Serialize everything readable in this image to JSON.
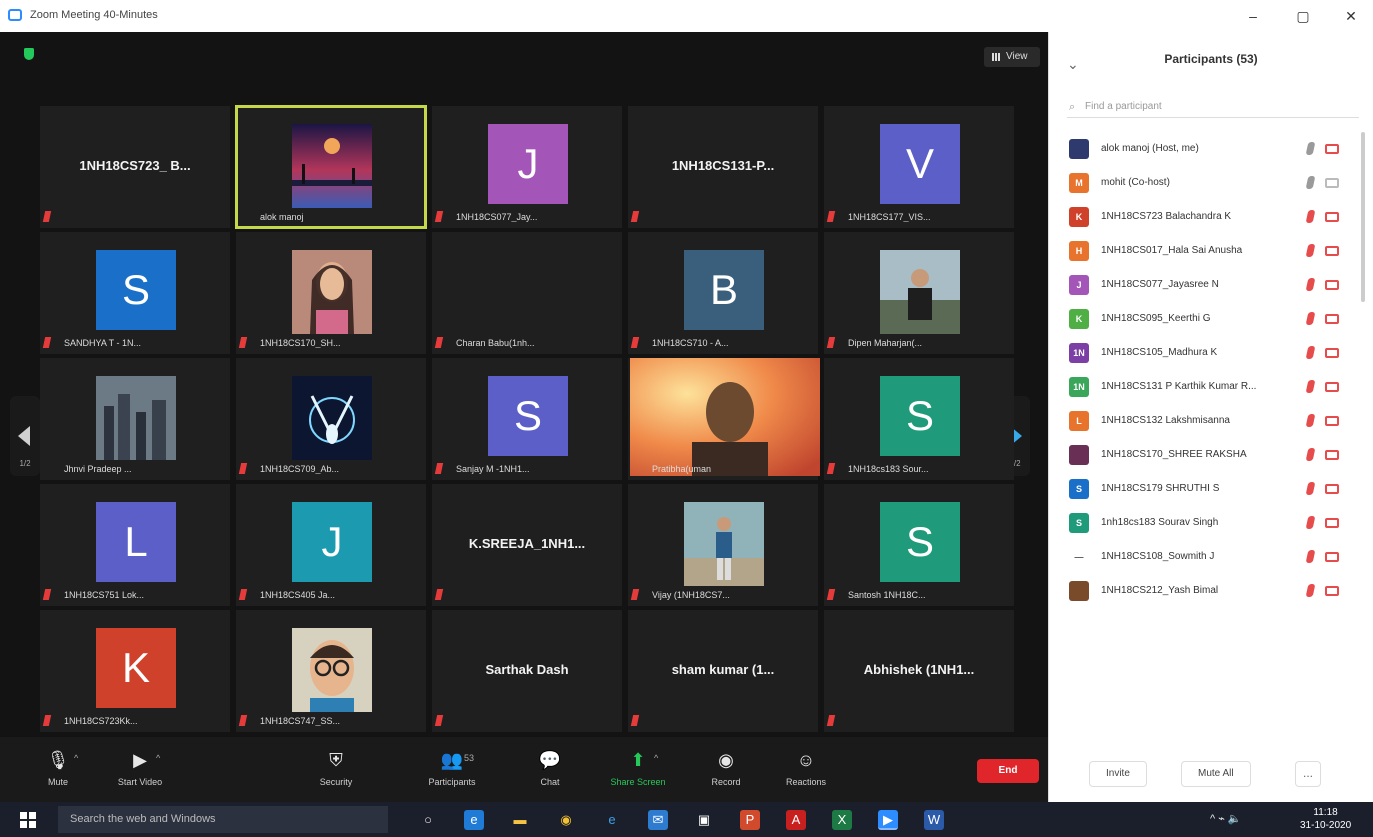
{
  "window": {
    "title": "Zoom Meeting 40-Minutes",
    "controls": [
      "–",
      "▢",
      "✕"
    ]
  },
  "meeting": {
    "view_label": "View",
    "nav_left_page": "1/2",
    "nav_right_page": "1/2",
    "tiles": [
      {
        "type": "text",
        "label": "1NH18CS723_ B...",
        "muted": true
      },
      {
        "type": "photo",
        "photo": "sunset-art",
        "name": "alok manoj",
        "muted": false,
        "active": true
      },
      {
        "type": "avatar",
        "letter": "J",
        "color": "#a455b8",
        "name": "1NH18CS077_Jay...",
        "muted": true
      },
      {
        "type": "text",
        "label": "1NH18CS131-P...",
        "muted": true
      },
      {
        "type": "avatar",
        "letter": "V",
        "color": "#5b5fc7",
        "name": "1NH18CS177_VIS...",
        "muted": true
      },
      {
        "type": "avatar",
        "letter": "S",
        "color": "#1a6fc9",
        "name": "SANDHYA T - 1N...",
        "muted": true
      },
      {
        "type": "photo",
        "photo": "woman-portrait",
        "name": "1NH18CS170_SH...",
        "muted": true
      },
      {
        "type": "blank",
        "name": "Charan Babu(1nh...",
        "muted": true
      },
      {
        "type": "avatar",
        "letter": "B",
        "color": "#3a5f7d",
        "name": "1NH18CS710 - A...",
        "muted": true
      },
      {
        "type": "photo",
        "photo": "man-outdoor",
        "name": "Dipen Maharjan(...",
        "muted": true
      },
      {
        "type": "photo",
        "photo": "city-skyline",
        "name": "Jhnvi Pradeep ...",
        "muted": false
      },
      {
        "type": "photo",
        "photo": "deer-art",
        "name": "1NH18CS709_Ab...",
        "muted": true
      },
      {
        "type": "avatar",
        "letter": "S",
        "color": "#5b5fc7",
        "name": "Sanjay M -1NH1...",
        "muted": true
      },
      {
        "type": "video",
        "photo": "live-video",
        "name": "Pratibha(uman",
        "muted": false
      },
      {
        "type": "avatar",
        "letter": "S",
        "color": "#1f9a7a",
        "name": "1NH18cs183 Sour...",
        "muted": true
      },
      {
        "type": "avatar",
        "letter": "L",
        "color": "#5b5fc7",
        "name": "1NH18CS751 Lok...",
        "muted": true
      },
      {
        "type": "avatar",
        "letter": "J",
        "color": "#1c9bb0",
        "name": "1NH18CS405 Ja...",
        "muted": true
      },
      {
        "type": "text",
        "label": "K.SREEJA_1NH1...",
        "muted": true
      },
      {
        "type": "photo",
        "photo": "man-standing",
        "name": "Vijay (1NH18CS7...",
        "muted": true
      },
      {
        "type": "avatar",
        "letter": "S",
        "color": "#1f9a7a",
        "name": "Santosh 1NH18C...",
        "muted": true
      },
      {
        "type": "avatar",
        "letter": "K",
        "color": "#d0412b",
        "name": "1NH18CS723Kk...",
        "muted": true
      },
      {
        "type": "photo",
        "photo": "man-glasses",
        "name": "1NH18CS747_SS...",
        "muted": true
      },
      {
        "type": "text",
        "label": "Sarthak Dash",
        "muted": true
      },
      {
        "type": "text",
        "label": "sham kumar (1...",
        "muted": true
      },
      {
        "type": "text",
        "label": "Abhishek (1NH1...",
        "muted": true
      }
    ]
  },
  "toolbar": {
    "mute": "Mute",
    "start_video": "Start Video",
    "security": "Security",
    "participants": "Participants",
    "participants_count": "53",
    "chat": "Chat",
    "share_screen": "Share Screen",
    "record": "Record",
    "reactions": "Reactions",
    "end": "End"
  },
  "panel": {
    "back": "⌄",
    "title": "Participants (53)",
    "search_placeholder": "Find a participant",
    "participants": [
      {
        "name": "alok manoj (Host, me)",
        "avatar": "",
        "color": "#2e3a6e",
        "mic_muted": false,
        "cam_off": true,
        "photo": true
      },
      {
        "name": "mohit (Co-host)",
        "avatar": "M",
        "color": "#e8732c",
        "mic_muted": false,
        "cam_off": false
      },
      {
        "name": "1NH18CS723 Balachandra K",
        "avatar": "K",
        "color": "#d0412b",
        "mic_muted": true,
        "cam_off": true
      },
      {
        "name": "1NH18CS017_Hala Sai Anusha",
        "avatar": "H",
        "color": "#e8732c",
        "mic_muted": true,
        "cam_off": true
      },
      {
        "name": "1NH18CS077_Jayasree N",
        "avatar": "J",
        "color": "#a455b8",
        "mic_muted": true,
        "cam_off": true
      },
      {
        "name": "1NH18CS095_Keerthi G",
        "avatar": "K",
        "color": "#4fae44",
        "mic_muted": true,
        "cam_off": true
      },
      {
        "name": "1NH18CS105_Madhura K",
        "avatar": "1N",
        "color": "#7b3fa6",
        "mic_muted": true,
        "cam_off": true
      },
      {
        "name": "1NH18CS131 P Karthik Kumar R...",
        "avatar": "1N",
        "color": "#3aa65a",
        "mic_muted": true,
        "cam_off": true
      },
      {
        "name": "1NH18CS132 Lakshmisanna",
        "avatar": "L",
        "color": "#e8732c",
        "mic_muted": true,
        "cam_off": true
      },
      {
        "name": "1NH18CS170_SHREE RAKSHA",
        "avatar": "",
        "color": "#6a2f55",
        "mic_muted": true,
        "cam_off": true,
        "photo": true
      },
      {
        "name": "1NH18CS179 SHRUTHI S",
        "avatar": "S",
        "color": "#1a6fc9",
        "mic_muted": true,
        "cam_off": true
      },
      {
        "name": "1nh18cs183 Sourav Singh",
        "avatar": "S",
        "color": "#1f9a7a",
        "mic_muted": true,
        "cam_off": true
      },
      {
        "name": "1NH18CS108_Sowmith J",
        "avatar": "—",
        "color": "#555555",
        "mic_muted": true,
        "cam_off": true,
        "dash": true
      },
      {
        "name": "1NH18CS212_Yash Bimal",
        "avatar": "",
        "color": "#7a4b2b",
        "mic_muted": true,
        "cam_off": true,
        "photo": true
      }
    ],
    "mute_all_self": "Invite",
    "mute_all": "Mute All",
    "more": "..."
  },
  "taskbar": {
    "search_placeholder": "Search the web and Windows",
    "apps": [
      "task-view",
      "edge",
      "file-explorer",
      "chrome",
      "ie",
      "mail",
      "store",
      "powerpoint",
      "acrobat",
      "excel",
      "zoom",
      "word"
    ],
    "tray": "^ ⌁ 🔈",
    "time": "11:18",
    "date": "31-10-2020"
  }
}
